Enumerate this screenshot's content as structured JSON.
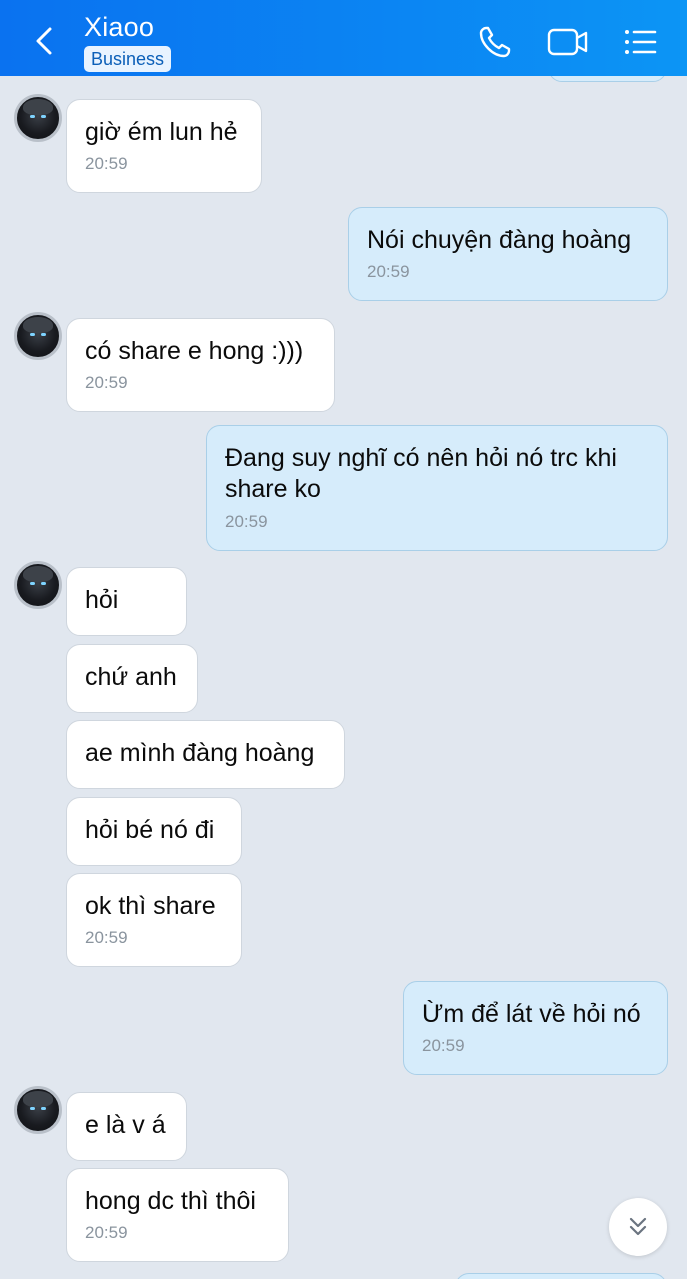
{
  "header": {
    "title": "Xiaoo",
    "badge": "Business",
    "icons": [
      "back-icon",
      "phone-icon",
      "video-call-icon",
      "menu-list-icon"
    ]
  },
  "messages": [
    {
      "id": "m1",
      "side": "in",
      "text": "giờ ém lun hẻ",
      "time": "20:59"
    },
    {
      "id": "m2",
      "side": "out",
      "text": "Nói chuyện đàng hoàng",
      "time": "20:59"
    },
    {
      "id": "m3",
      "side": "in",
      "text": "có share e hong :)))",
      "time": "20:59"
    },
    {
      "id": "m4",
      "side": "out",
      "text": "Đang suy nghĩ có nên hỏi nó trc khi share ko",
      "time": "20:59"
    },
    {
      "id": "m5",
      "side": "in",
      "text": "hỏi",
      "time": ""
    },
    {
      "id": "m6",
      "side": "in",
      "text": "chứ anh",
      "time": ""
    },
    {
      "id": "m7",
      "side": "in",
      "text": "ae mình đàng hoàng",
      "time": ""
    },
    {
      "id": "m8",
      "side": "in",
      "text": "hỏi bé nó đi",
      "time": ""
    },
    {
      "id": "m9",
      "side": "in",
      "text": "ok thì share",
      "time": "20:59"
    },
    {
      "id": "m10",
      "side": "out",
      "text": "Ừm để lát về hỏi nó",
      "time": "20:59"
    },
    {
      "id": "m11",
      "side": "in",
      "text": "e là v á",
      "time": ""
    },
    {
      "id": "m12",
      "side": "in",
      "text": "hong dc thì thôi",
      "time": "20:59"
    }
  ],
  "colors": {
    "header_gradient_start": "#0a72f0",
    "header_gradient_end": "#0c95f5",
    "background": "#e1e7ef",
    "bubble_in": "#ffffff",
    "bubble_out": "#d6ecfb",
    "time_text": "#8a949e"
  }
}
